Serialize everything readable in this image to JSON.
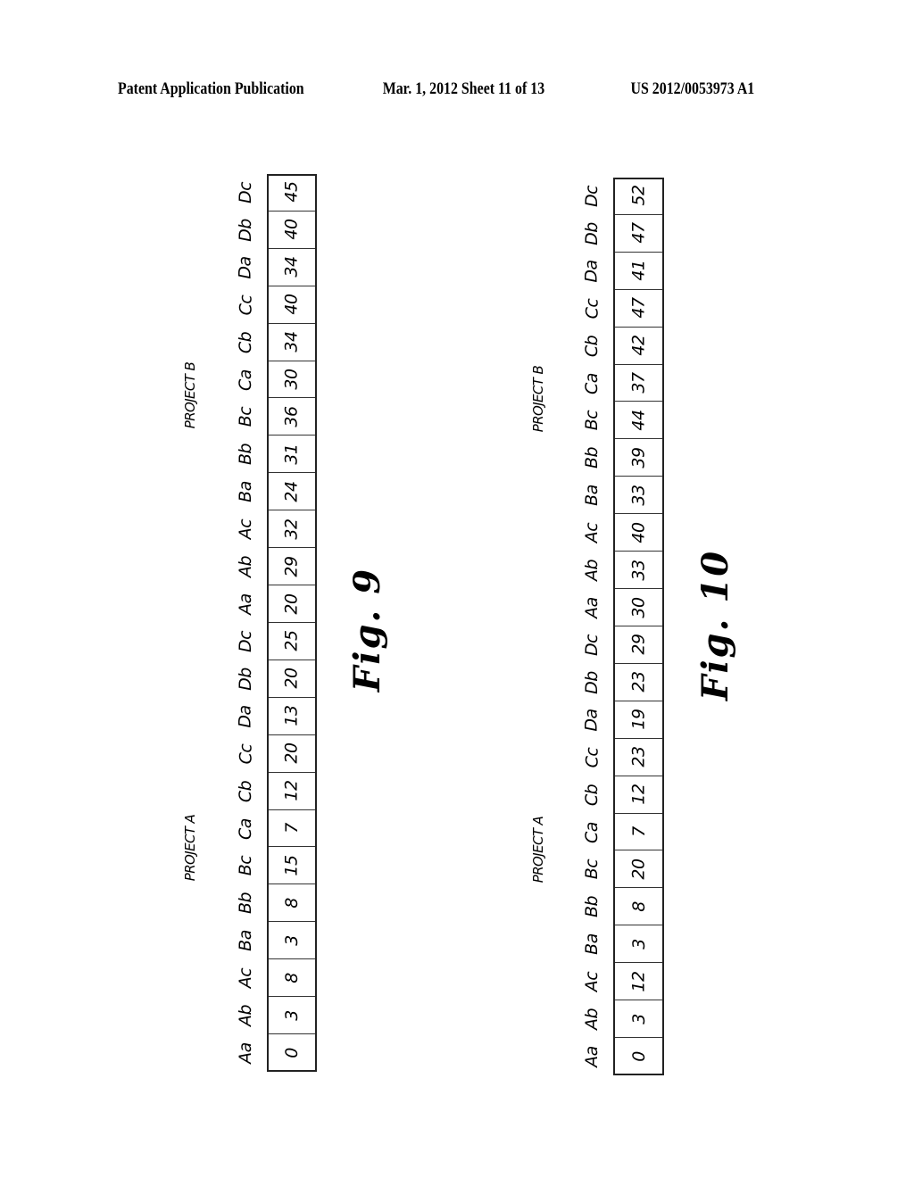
{
  "header": {
    "left": "Patent Application Publication",
    "middle": "Mar. 1, 2012   Sheet 11 of 13",
    "right": "US 2012/0053973 A1"
  },
  "figures": [
    {
      "caption": "Fig.  9",
      "project_a_label": "PROJECT A",
      "project_b_label": "PROJECT B",
      "labels": [
        "Aa",
        "Ab",
        "Ac",
        "Ba",
        "Bb",
        "Bc",
        "Ca",
        "Cb",
        "Cc",
        "Da",
        "Db",
        "Dc",
        "Aa",
        "Ab",
        "Ac",
        "Ba",
        "Bb",
        "Bc",
        "Ca",
        "Cb",
        "Cc",
        "Da",
        "Db",
        "Dc"
      ],
      "values": [
        "0",
        "3",
        "8",
        "3",
        "8",
        "15",
        "7",
        "12",
        "20",
        "13",
        "20",
        "25",
        "20",
        "29",
        "32",
        "24",
        "31",
        "36",
        "30",
        "34",
        "40",
        "34",
        "40",
        "45"
      ]
    },
    {
      "caption": "Fig.  10",
      "project_a_label": "PROJECT A",
      "project_b_label": "PROJECT B",
      "labels": [
        "Aa",
        "Ab",
        "Ac",
        "Ba",
        "Bb",
        "Bc",
        "Ca",
        "Cb",
        "Cc",
        "Da",
        "Db",
        "Dc",
        "Aa",
        "Ab",
        "Ac",
        "Ba",
        "Bb",
        "Bc",
        "Ca",
        "Cb",
        "Cc",
        "Da",
        "Db",
        "Dc"
      ],
      "values": [
        "0",
        "3",
        "12",
        "3",
        "8",
        "20",
        "7",
        "12",
        "23",
        "19",
        "23",
        "29",
        "30",
        "33",
        "40",
        "33",
        "39",
        "44",
        "37",
        "42",
        "47",
        "41",
        "47",
        "52"
      ]
    }
  ]
}
